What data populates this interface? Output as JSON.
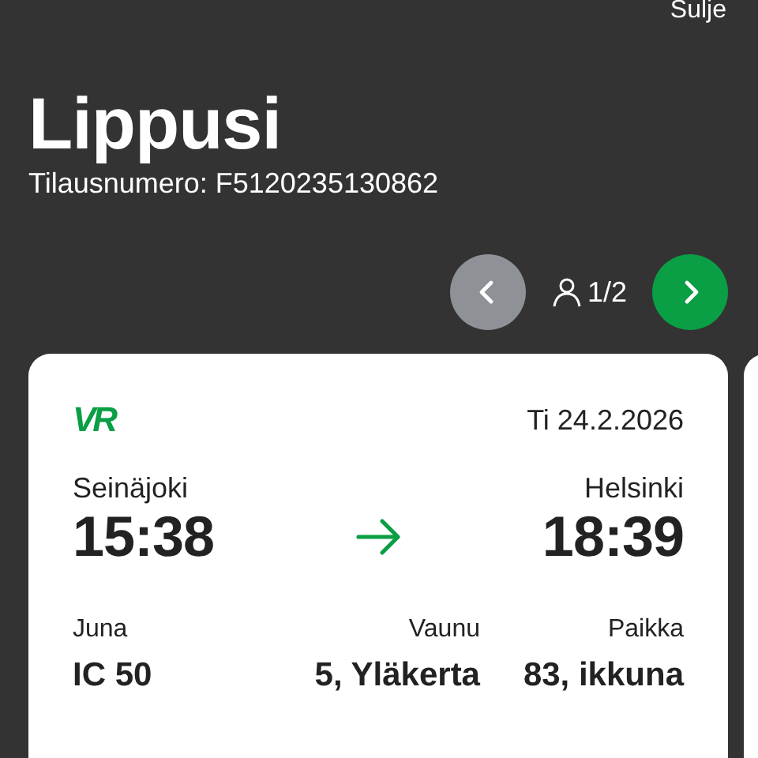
{
  "header": {
    "close_label": "Sulje",
    "title": "Lippusi",
    "order_number": "Tilausnumero: F5120235130862"
  },
  "pager": {
    "previous": {
      "disabled": true
    },
    "next": {
      "disabled": false
    },
    "count": "1/2"
  },
  "ticket": {
    "logo": "VR",
    "date": "Ti 24.2.2026",
    "from": {
      "station": "Seinäjoki",
      "time": "15:38"
    },
    "to": {
      "station": "Helsinki",
      "time": "18:39"
    },
    "details": [
      {
        "label": "Juna",
        "value": "IC 50"
      },
      {
        "label": "Vaunu",
        "value": "5, Yläkerta"
      },
      {
        "label": "Paikka",
        "value": "83, ikkuna"
      }
    ]
  }
}
